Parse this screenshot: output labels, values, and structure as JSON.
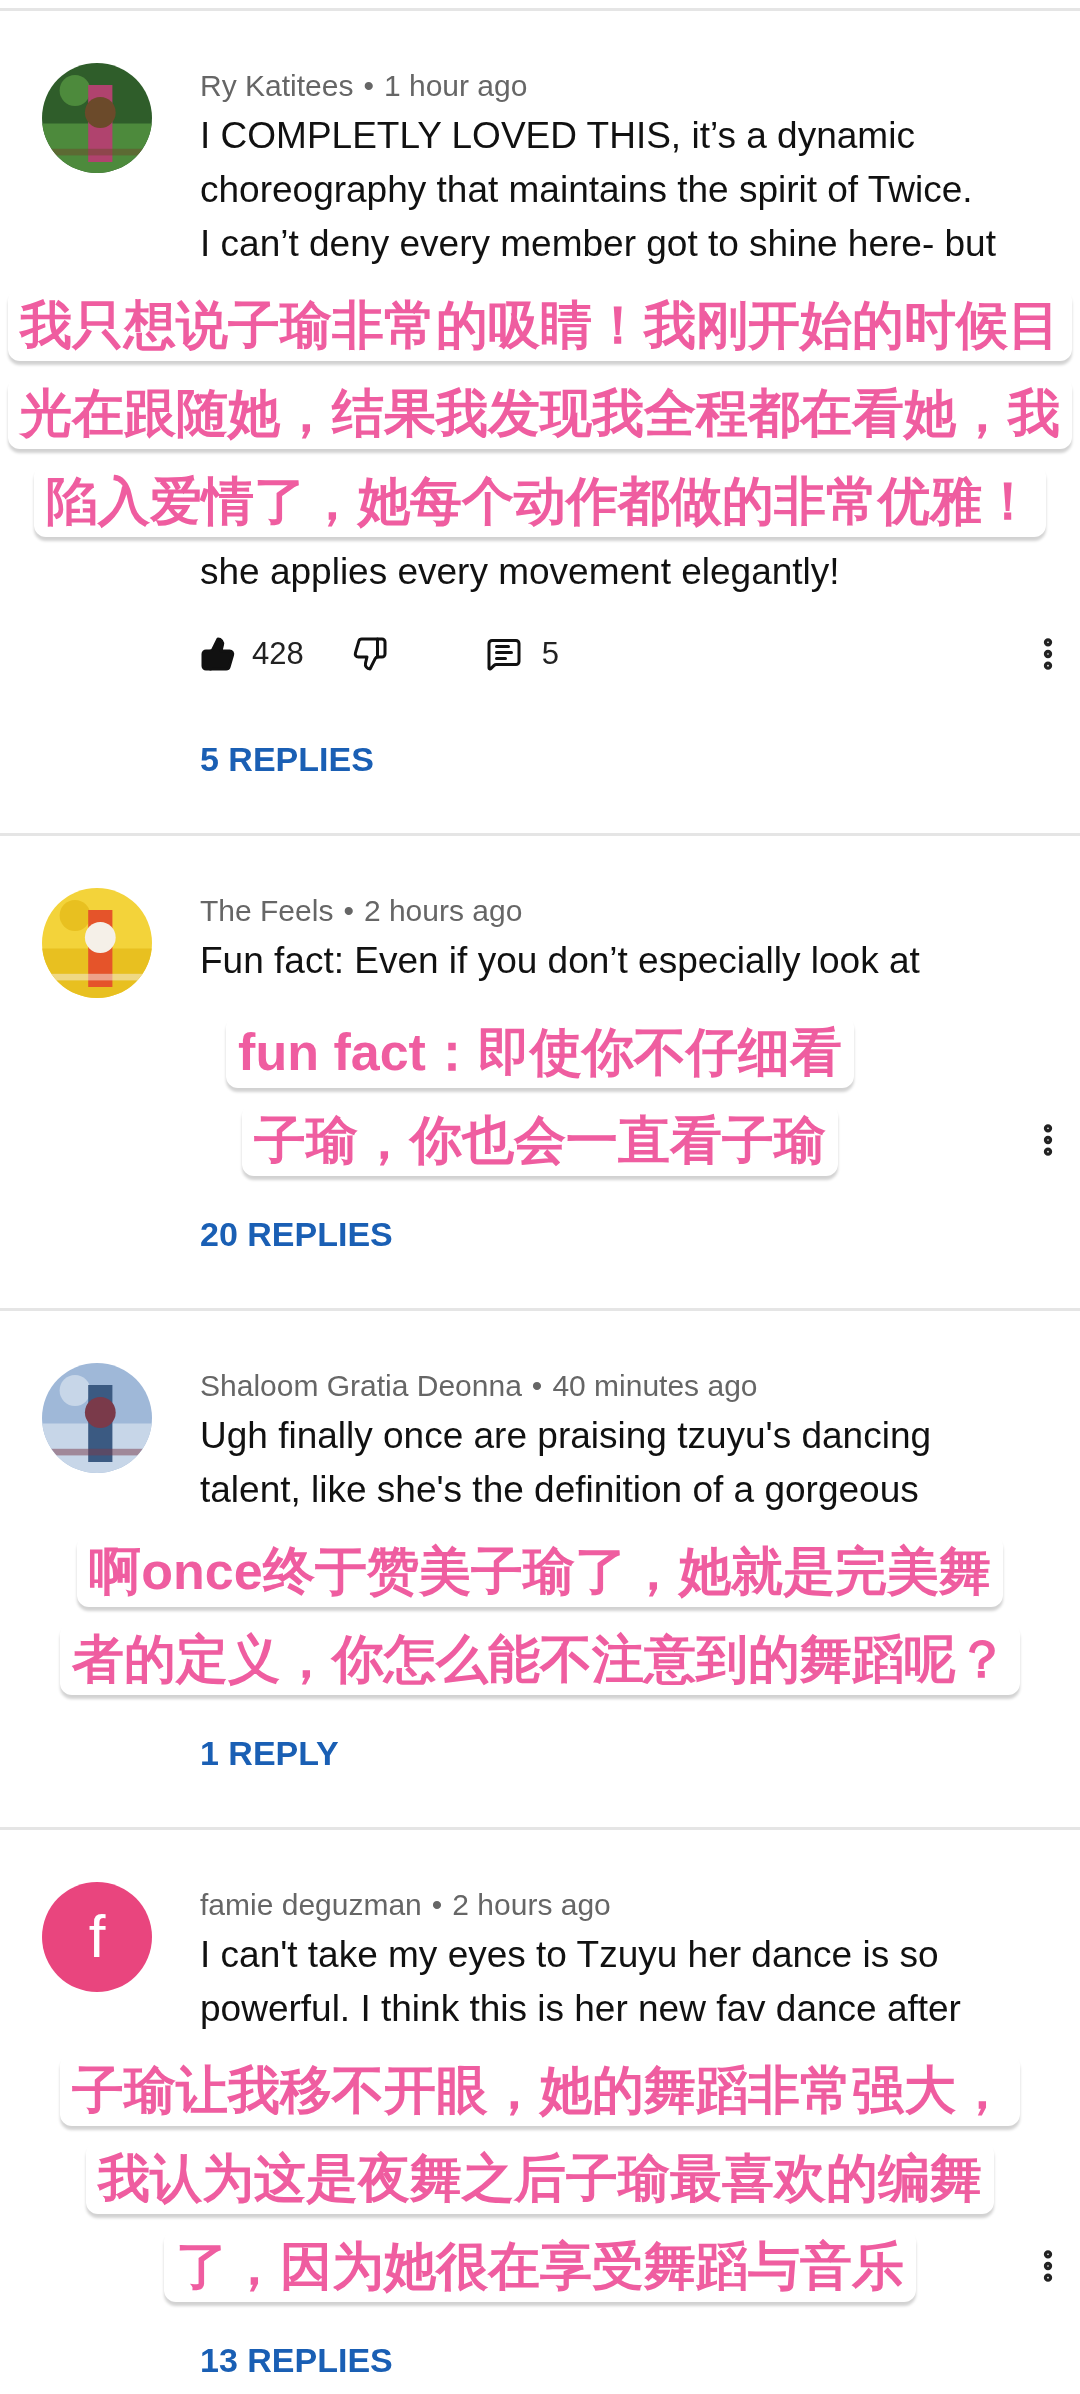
{
  "comments": [
    {
      "author": "Ry Katitees",
      "separator": "•",
      "time": "1 hour ago",
      "avatar": {
        "kind": "picture"
      },
      "lines": [
        "I COMPLETLY LOVED THIS, it’s a dynamic",
        "choreography that maintains the spirit of Twice.",
        "I can’t deny every member got to shine here- but"
      ],
      "body": [
        {
          "kind": "caption",
          "text": "我只想说子瑜非常的吸睛！我刚开始的时候目"
        },
        {
          "kind": "caption",
          "text": "光在跟随她，结果我发现我全程都在看她，我"
        },
        {
          "kind": "caption",
          "text": "陷入爱情了，她每个动作都做的非常优雅！"
        },
        {
          "kind": "text",
          "text": "she applies every movement elegantly!"
        }
      ],
      "actions": {
        "likes": "428",
        "replies_count": "5"
      },
      "menu_visible": true,
      "replies": "5 REPLIES"
    },
    {
      "author": "The Feels",
      "separator": "•",
      "time": "2 hours ago",
      "avatar": {
        "kind": "picture"
      },
      "lines": [
        "Fun fact: Even if you don’t especially look at"
      ],
      "body": [
        {
          "kind": "caption",
          "text": "fun fact：即使你不仔细看"
        },
        {
          "kind": "caption",
          "text": "子瑜，你也会一直看子瑜"
        }
      ],
      "menu_visible": true,
      "replies": "20 REPLIES"
    },
    {
      "author": "Shaloom Gratia Deonna",
      "separator": "•",
      "time": "40 minutes ago",
      "avatar": {
        "kind": "picture"
      },
      "lines": [
        "Ugh finally once are praising tzuyu's dancing",
        "talent, like she's the definition of a gorgeous"
      ],
      "body": [
        {
          "kind": "caption",
          "text": "啊once终于赞美子瑜了，她就是完美舞"
        },
        {
          "kind": "caption",
          "text": "者的定义，你怎么能不注意到的舞蹈呢？"
        }
      ],
      "menu_visible": false,
      "replies": "1 REPLY"
    },
    {
      "author": "famie deguzman",
      "separator": "•",
      "time": "2 hours ago",
      "avatar": {
        "kind": "letter",
        "letter": "f",
        "color": "#e9457e"
      },
      "lines": [
        "I can't take my eyes to Tzuyu her dance is so",
        "powerful. I think this is her new fav dance after"
      ],
      "body": [
        {
          "kind": "caption",
          "text": "子瑜让我移不开眼，她的舞蹈非常强大，"
        },
        {
          "kind": "caption",
          "text": "我认为这是夜舞之后子瑜最喜欢的编舞"
        },
        {
          "kind": "caption",
          "text": "了，因为她很在享受舞蹈与音乐"
        }
      ],
      "menu_visible": true,
      "replies": "13 REPLIES"
    }
  ]
}
